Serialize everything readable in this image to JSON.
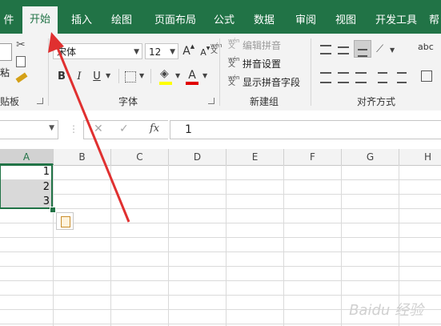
{
  "tabs": {
    "partial_file": "件",
    "home": "开始",
    "insert": "插入",
    "draw": "绘图",
    "page_layout": "页面布局",
    "formulas": "公式",
    "data": "数据",
    "review": "审阅",
    "view": "视图",
    "developer": "开发工具",
    "partial_more": "帮"
  },
  "clipboard": {
    "paste_partial": "粘",
    "group_label_partial": "贴板"
  },
  "font": {
    "name": "宋体",
    "size": "12",
    "bold": "B",
    "italic": "I",
    "underline": "U",
    "grow": "A",
    "shrink": "A",
    "wen_zi": "wén",
    "wen_char": "文",
    "font_color_letter": "A",
    "group_label": "字体",
    "colors": {
      "highlight": "#ffff00",
      "font_color": "#e00000"
    }
  },
  "phonetic": {
    "edit": "编辑拼音",
    "settings": "拼音设置",
    "show_field": "显示拼音字段",
    "group_label": "新建组"
  },
  "alignment": {
    "group_label": "对齐方式",
    "abc": "abc"
  },
  "formula_bar": {
    "namebox_value": "",
    "cancel": "✕",
    "enter": "✓",
    "fx": "fx",
    "value": "1"
  },
  "grid": {
    "columns": [
      "A",
      "B",
      "C",
      "D",
      "E",
      "F",
      "G",
      "H"
    ],
    "cells_A": [
      "1",
      "2",
      "3"
    ],
    "selected_column": "A"
  },
  "watermark": "Baidu 经验",
  "accent_color": "#217346",
  "annotation_arrow_color": "#e03030"
}
